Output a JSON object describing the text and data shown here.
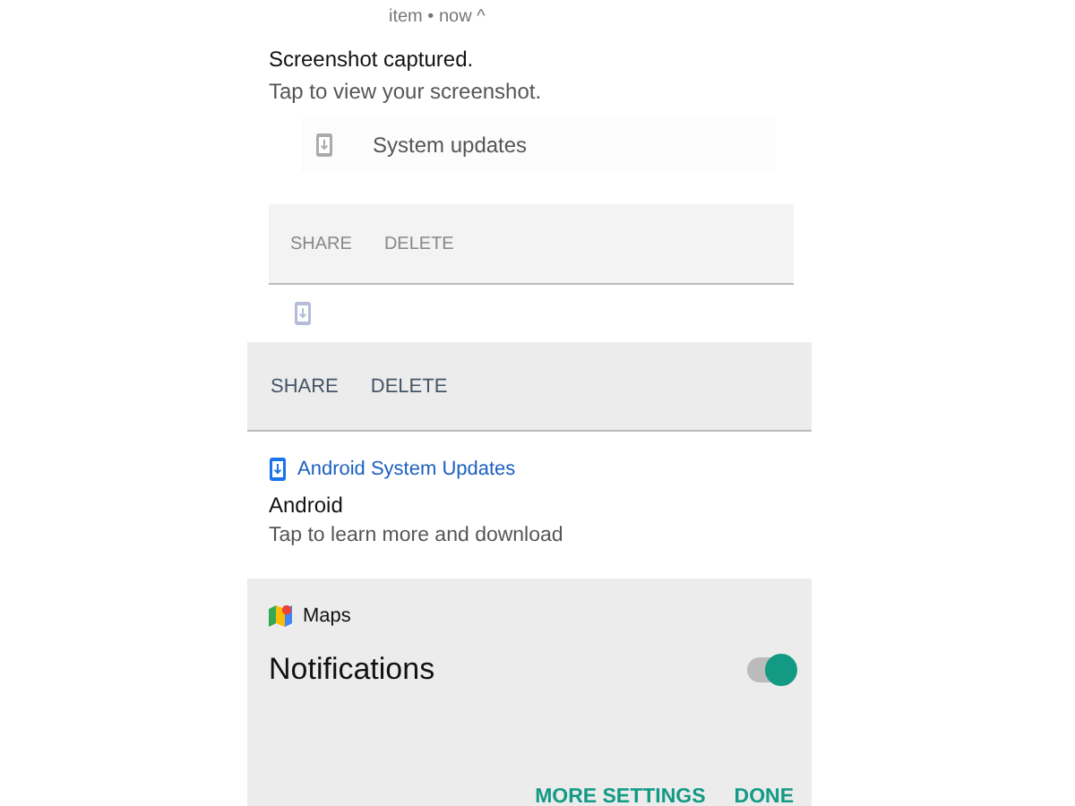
{
  "top_card": {
    "header": "item • now ^",
    "title": "Screenshot captured.",
    "subtitle": "Tap to view your screenshot.",
    "update_row": {
      "label": "System updates"
    },
    "actions": [
      "SHARE",
      "DELETE"
    ]
  },
  "main_card": {
    "actions": [
      "SHARE",
      "DELETE"
    ],
    "update": {
      "app": "Android System Updates",
      "title": "Android",
      "text": "Tap to learn more and download"
    }
  },
  "settings_panel": {
    "app": "Maps",
    "label": "Notifications",
    "on": true,
    "buttons": [
      "MORE SETTINGS",
      "DONE"
    ]
  }
}
